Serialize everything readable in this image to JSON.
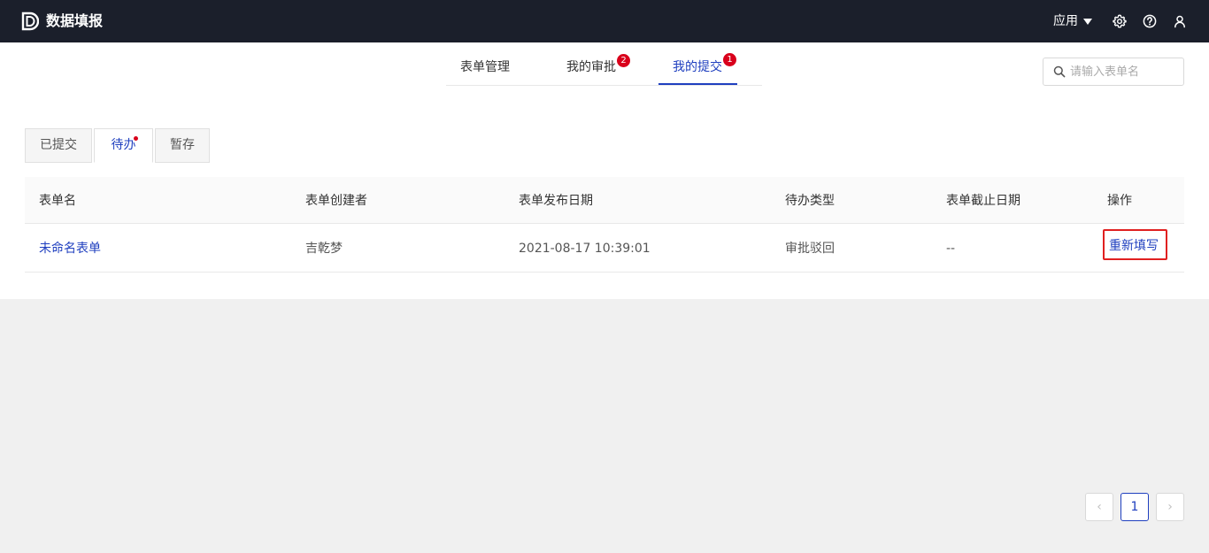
{
  "header": {
    "title": "数据填报",
    "apps_label": "应用",
    "icons": [
      "logo-icon",
      "settings-icon",
      "help-icon",
      "user-icon"
    ]
  },
  "nav": {
    "tabs": [
      {
        "label": "表单管理"
      },
      {
        "label": "我的审批",
        "badge": "2"
      },
      {
        "label": "我的提交",
        "badge": "1",
        "active": true
      }
    ],
    "search_placeholder": "请输入表单名"
  },
  "subtabs": [
    {
      "label": "已提交"
    },
    {
      "label": "待办",
      "active": true,
      "has_dot": true
    },
    {
      "label": "暂存"
    }
  ],
  "table": {
    "columns": [
      "表单名",
      "表单创建者",
      "表单发布日期",
      "待办类型",
      "表单截止日期",
      "操作"
    ],
    "rows": [
      {
        "name": "未命名表单",
        "creator": "吉乾梦",
        "published": "2021-08-17 10:39:01",
        "todo_type": "审批驳回",
        "deadline": "--",
        "action": "重新填写"
      }
    ]
  },
  "pagination": {
    "prev": "‹",
    "current": "1",
    "next": "›"
  },
  "colors": {
    "topbar": "#1b1f2b",
    "accent": "#1f3fbf",
    "badge": "#d9001b",
    "highlight": "#e02020"
  }
}
